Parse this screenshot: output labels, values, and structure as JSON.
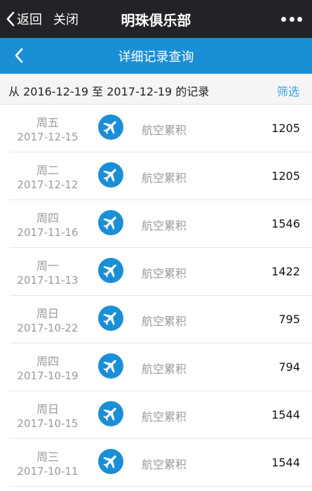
{
  "topbar": {
    "back_label": "返回",
    "close_label": "关闭",
    "title": "明珠俱乐部",
    "more_icon": "more-dots-icon"
  },
  "navbar": {
    "title": "详细记录查询",
    "back_icon": "chevron-left-icon"
  },
  "filter": {
    "range_text": "从 2016-12-19 至 2017-12-19 的记录",
    "filter_label": "筛选"
  },
  "records": [
    {
      "weekday": "周五",
      "date": "2017-12-15",
      "type": "航空累积",
      "amount": "1205",
      "icon": "airplane-icon"
    },
    {
      "weekday": "周二",
      "date": "2017-12-12",
      "type": "航空累积",
      "amount": "1205",
      "icon": "airplane-icon"
    },
    {
      "weekday": "周四",
      "date": "2017-11-16",
      "type": "航空累积",
      "amount": "1546",
      "icon": "airplane-icon"
    },
    {
      "weekday": "周一",
      "date": "2017-11-13",
      "type": "航空累积",
      "amount": "1422",
      "icon": "airplane-icon"
    },
    {
      "weekday": "周日",
      "date": "2017-10-22",
      "type": "航空累积",
      "amount": "795",
      "icon": "airplane-icon"
    },
    {
      "weekday": "周四",
      "date": "2017-10-19",
      "type": "航空累积",
      "amount": "794",
      "icon": "airplane-icon"
    },
    {
      "weekday": "周日",
      "date": "2017-10-15",
      "type": "航空累积",
      "amount": "1544",
      "icon": "airplane-icon"
    },
    {
      "weekday": "周三",
      "date": "2017-10-11",
      "type": "航空累积",
      "amount": "1544",
      "icon": "airplane-icon"
    }
  ],
  "colors": {
    "topbar_bg": "#222326",
    "accent_blue": "#1a8fd6",
    "filter_link": "#3aa0e0",
    "muted_text": "#9a9a9a"
  }
}
